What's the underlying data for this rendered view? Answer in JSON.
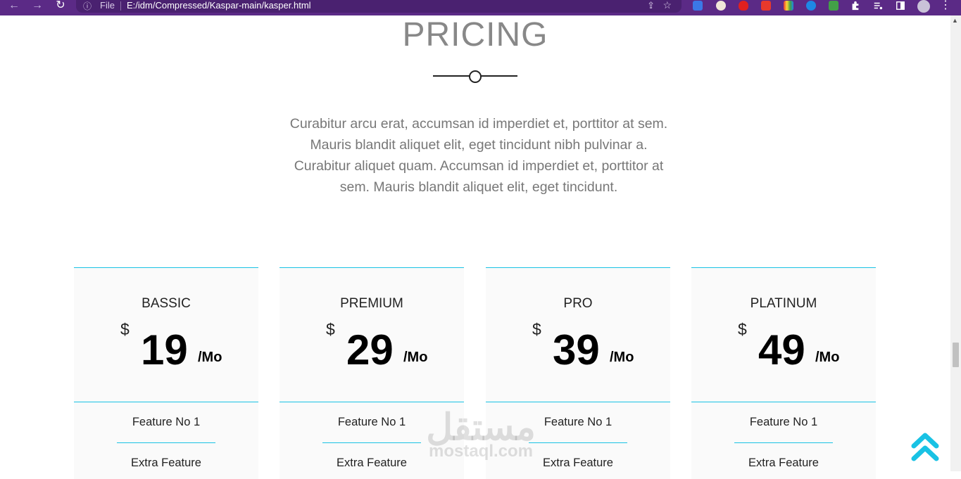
{
  "browser": {
    "back_icon": "←",
    "forward_icon": "→",
    "reload_icon": "↻",
    "info_icon": "ⓘ",
    "scheme_label": "File",
    "url": "E:/idm/Compressed/Kaspar-main/kasper.html",
    "share_icon": "⇪",
    "star_icon": "☆",
    "menu_icon": "⋮"
  },
  "pricing": {
    "title": "PRICING",
    "intro": "Curabitur arcu erat, accumsan id imperdiet et, porttitor at sem. Mauris blandit aliquet elit, eget tincidunt nibh pulvinar a. Curabitur aliquet quam. Accumsan id imperdiet et, porttitor at sem. Mauris blandit aliquet elit, eget tincidunt.",
    "plans": [
      {
        "name": "BASSIC",
        "currency": "$",
        "price": "19",
        "period": "/Mo",
        "feature1": "Feature No 1",
        "feature2": "Extra Feature"
      },
      {
        "name": "PREMIUM",
        "currency": "$",
        "price": "29",
        "period": "/Mo",
        "feature1": "Feature No 1",
        "feature2": "Extra Feature"
      },
      {
        "name": "PRO",
        "currency": "$",
        "price": "39",
        "period": "/Mo",
        "feature1": "Feature No 1",
        "feature2": "Extra Feature"
      },
      {
        "name": "PLATINUM",
        "currency": "$",
        "price": "49",
        "period": "/Mo",
        "feature1": "Feature No 1",
        "feature2": "Extra Feature"
      }
    ]
  },
  "watermark": {
    "arabic": "مستقل",
    "latin": "mostaql.com"
  },
  "colors": {
    "accent": "#19c2e4",
    "chrome": "#5b2a86",
    "text_muted": "#777777"
  }
}
